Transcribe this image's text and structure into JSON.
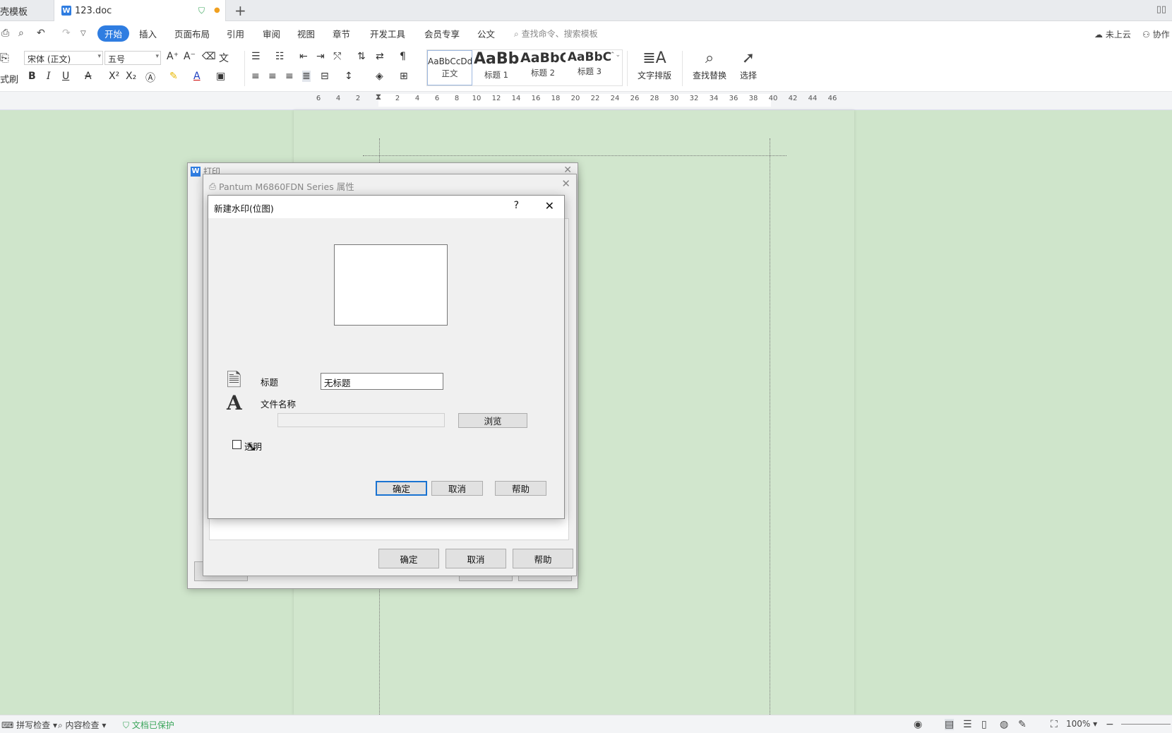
{
  "tabs": {
    "template_tab": "壳模板",
    "doc_tab": "123.doc",
    "new_tab_icon": "plus-icon"
  },
  "menu": {
    "items": [
      "开始",
      "插入",
      "页面布局",
      "引用",
      "审阅",
      "视图",
      "章节",
      "开发工具",
      "会员专享",
      "公文"
    ],
    "search_placeholder": "查找命令、搜索模板",
    "cloud_status": "未上云",
    "collab": "协作"
  },
  "ribbon": {
    "format_painter_label": "式刷",
    "font_name": "宋体 (正文)",
    "font_size": "五号",
    "styles": [
      {
        "sample": "AaBbCcDd",
        "name": "正文"
      },
      {
        "sample": "AaBb",
        "name": "标题 1"
      },
      {
        "sample": "AaBbC",
        "name": "标题 2"
      },
      {
        "sample": "AaBbC",
        "name": "标题 3"
      }
    ],
    "text_layout_label": "文字排版",
    "find_replace_label": "查找替换",
    "select_label": "选择",
    "accent_color": "#2f7de1"
  },
  "ruler": {
    "ticks": [
      "6",
      "4",
      "2",
      "2",
      "4",
      "6",
      "8",
      "10",
      "12",
      "14",
      "16",
      "18",
      "20",
      "22",
      "24",
      "26",
      "28",
      "30",
      "32",
      "34",
      "36",
      "38",
      "40",
      "42",
      "44",
      "46"
    ]
  },
  "print_dialog": {
    "title": "打印"
  },
  "props_dialog": {
    "title": "Pantum M6860FDN Series 属性",
    "ok": "确定",
    "cancel": "取消",
    "help": "帮助"
  },
  "watermark_dialog": {
    "title": "新建水印(位图)",
    "help_icon": "?",
    "title_label": "标题",
    "title_value": "无标题",
    "filename_label": "文件名称",
    "filename_value": "",
    "browse": "浏览",
    "transparent_label": "透明",
    "transparent_checked": false,
    "ok": "确定",
    "cancel": "取消",
    "help": "帮助"
  },
  "statusbar": {
    "spell_check": "拼写检查",
    "content_check": "内容检查",
    "protected": "文档已保护",
    "zoom": "100%"
  }
}
